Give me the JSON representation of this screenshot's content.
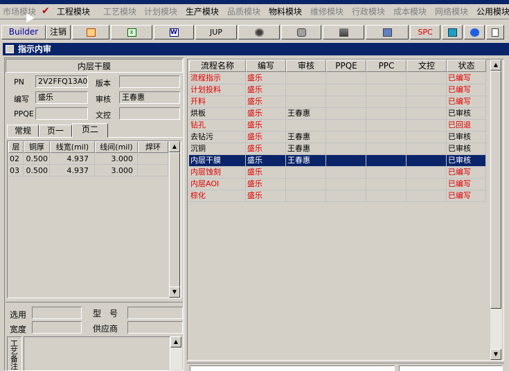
{
  "menu": {
    "items": [
      {
        "label": "市场模块",
        "enabled": false
      },
      {
        "label": "工程模块",
        "enabled": true
      },
      {
        "label": "工艺模块",
        "enabled": false
      },
      {
        "label": "计划模块",
        "enabled": false
      },
      {
        "label": "生产模块",
        "enabled": true
      },
      {
        "label": "品质模块",
        "enabled": false
      },
      {
        "label": "物料模块",
        "enabled": true
      },
      {
        "label": "维修模块",
        "enabled": false
      },
      {
        "label": "行政模块",
        "enabled": false
      },
      {
        "label": "成本模块",
        "enabled": false
      },
      {
        "label": "网络模块",
        "enabled": false
      },
      {
        "label": "公用模块",
        "enabled": true
      }
    ]
  },
  "toolbar": {
    "builder": "Builder",
    "logout": "注销",
    "jup": "JUP",
    "spc": "SPC"
  },
  "window": {
    "title": "指示内审"
  },
  "left": {
    "title": "内层干膜",
    "pn_label": "PN",
    "pn_value": "2V2FFQ13A0",
    "version_label": "版本",
    "version_value": "",
    "writer_label": "编写",
    "writer_value": "盛乐",
    "reviewer_label": "审核",
    "reviewer_value": "王春惠",
    "ppqe_label": "PPQE",
    "ppqe_value": "",
    "control_label": "文控",
    "control_value": "",
    "tabs": [
      "常规",
      "页一",
      "页二"
    ],
    "active_tab": 2,
    "grid": {
      "headers": [
        "层",
        "铜厚",
        "线宽(mil)",
        "线间(mil)",
        "焊环"
      ],
      "rows": [
        [
          "02",
          "0.500",
          "4.937",
          "3.000",
          ""
        ],
        [
          "03",
          "0.500",
          "4.937",
          "3.000",
          ""
        ]
      ]
    },
    "select_label": "选用",
    "model_label": "型　号",
    "width_label": "宽度",
    "supplier_label": "供应商",
    "process_note_label": "工艺备注"
  },
  "flow": {
    "headers": [
      "流程名称",
      "编写",
      "审核",
      "PPQE",
      "PPC",
      "文控",
      "状态"
    ],
    "rows": [
      {
        "name": "流程指示",
        "writer": "盛乐",
        "reviewer": "",
        "ppqe": "",
        "ppc": "",
        "control": "",
        "status": "已编写",
        "red": true
      },
      {
        "name": "计划投料",
        "writer": "盛乐",
        "reviewer": "",
        "ppqe": "",
        "ppc": "",
        "control": "",
        "status": "已编写",
        "red": true
      },
      {
        "name": "开料",
        "writer": "盛乐",
        "reviewer": "",
        "ppqe": "",
        "ppc": "",
        "control": "",
        "status": "已编写",
        "red": true
      },
      {
        "name": "烘板",
        "writer": "盛乐",
        "reviewer": "王春惠",
        "ppqe": "",
        "ppc": "",
        "control": "",
        "status": "已审核",
        "red": false
      },
      {
        "name": "钻孔",
        "writer": "盛乐",
        "reviewer": "",
        "ppqe": "",
        "ppc": "",
        "control": "",
        "status": "已回退",
        "red": true
      },
      {
        "name": "去钻污",
        "writer": "盛乐",
        "reviewer": "王春惠",
        "ppqe": "",
        "ppc": "",
        "control": "",
        "status": "已审核",
        "red": false
      },
      {
        "name": "沉铜",
        "writer": "盛乐",
        "reviewer": "王春惠",
        "ppqe": "",
        "ppc": "",
        "control": "",
        "status": "已审核",
        "red": false
      },
      {
        "name": "内层干膜",
        "writer": "盛乐",
        "reviewer": "王春惠",
        "ppqe": "",
        "ppc": "",
        "control": "",
        "status": "已审核",
        "red": false,
        "selected": true
      },
      {
        "name": "内层蚀刻",
        "writer": "盛乐",
        "reviewer": "",
        "ppqe": "",
        "ppc": "",
        "control": "",
        "status": "已编写",
        "red": true
      },
      {
        "name": "内层AOI",
        "writer": "盛乐",
        "reviewer": "",
        "ppqe": "",
        "ppc": "",
        "control": "",
        "status": "已编写",
        "red": true
      },
      {
        "name": "棕化",
        "writer": "盛乐",
        "reviewer": "",
        "ppqe": "",
        "ppc": "",
        "control": "",
        "status": "已编写",
        "red": true
      }
    ]
  },
  "colors": {
    "title_bg": "#0a246a",
    "face": "#d4d0c8",
    "red_text": "#e00000"
  }
}
